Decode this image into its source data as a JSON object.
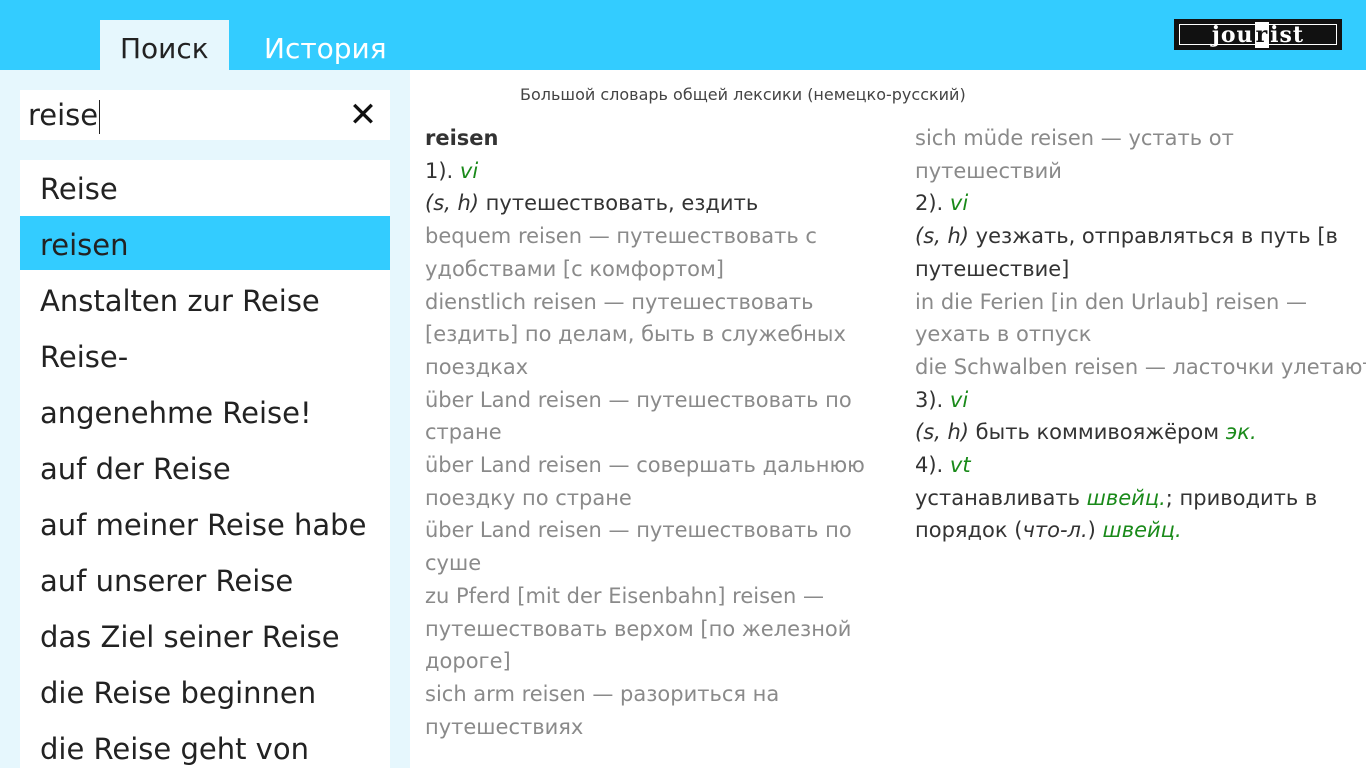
{
  "tabs": {
    "search": "Поиск",
    "history": "История"
  },
  "logo": {
    "left": "jou",
    "mid": "r",
    "right": "ist"
  },
  "search": {
    "value": "reise",
    "clear_icon": "close-icon"
  },
  "results": [
    "Reise",
    "reisen",
    "Anstalten zur Reise",
    "Reise-",
    "angenehme Reise!",
    "auf der Reise",
    "auf meiner Reise habe",
    "auf unserer Reise",
    "das Ziel seiner Reise",
    "die Reise beginnen",
    "die Reise geht von"
  ],
  "selected_index": 1,
  "colors": {
    "accent": "#33ccff",
    "panel": "#e6f7fd",
    "stress": "#d32020",
    "grammar": "#1a8a1a",
    "example": "#8a8a8a"
  },
  "dictionary": {
    "title": "Большой словарь общей лексики (немецко-русский)",
    "headword": "reisen",
    "col1": [
      "1). ",
      "vi",
      "(s, h)",
      " путешествовать, ездить",
      "bequem reisen — путешествовать с",
      "удобствами [с комфортом]",
      "dienstlich reisen — путешествовать",
      "[ездить] по делам, быть в служебных",
      "поездках",
      "über Land reisen — путешествовать по",
      "стране",
      "über Land reisen — совершать дальнюю",
      "поездку по стране",
      "über Land reisen — путешествовать по",
      "суше",
      "zu Pferd [mit der Eisenbahn] reisen —",
      "путешествовать верхом [по железной",
      "дороге]",
      "sich arm reisen — разориться на",
      "путешествиях"
    ],
    "col2": [
      "sich müde reisen — устать от",
      "путешествий",
      "2). ",
      "vi",
      "(s, h)",
      " уезжать, отправляться в путь [в",
      "путешествие]",
      "in die Ferien [in den Urlaub] reisen —",
      "уехать в отпуск",
      "die Schwalben reisen — ласточки улетают",
      "3). ",
      "vi",
      "(s, h)",
      " быть коммивояжёром ",
      "эк.",
      "4). ",
      "vt",
      "устанавливать ",
      "швейц.",
      "; приводить в",
      "порядок (",
      "что-л.",
      ") ",
      "швейц."
    ]
  }
}
